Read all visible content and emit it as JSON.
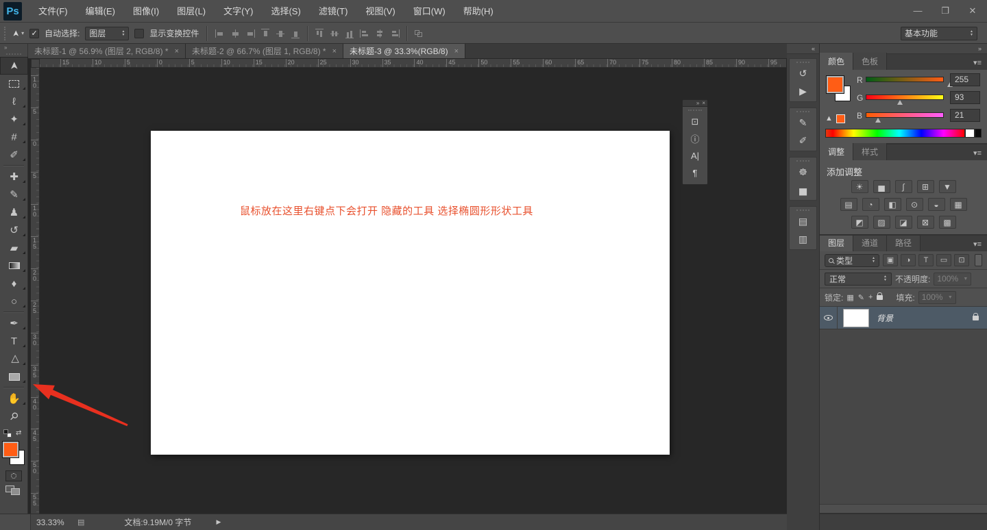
{
  "window": {
    "logo_text": "Ps",
    "minimize_glyph": "—",
    "maximize_glyph": "❐",
    "close_glyph": "✕"
  },
  "menu_items": [
    "文件(F)",
    "编辑(E)",
    "图像(I)",
    "图层(L)",
    "文字(Y)",
    "选择(S)",
    "滤镜(T)",
    "视图(V)",
    "窗口(W)",
    "帮助(H)"
  ],
  "options_bar": {
    "tool_glyph": "➤",
    "auto_select_label": "自动选择:",
    "auto_select_checked": true,
    "check_glyph": "✓",
    "target_value": "图层",
    "show_transform_label": "显示变换控件",
    "show_transform_checked": false,
    "align_icons": [
      "align-left",
      "align-hcenter",
      "align-right",
      "align-top",
      "align-vcenter",
      "align-bottom",
      "dist-top",
      "dist-vcenter",
      "dist-bottom",
      "dist-left",
      "dist-hcenter",
      "dist-right",
      "auto-align"
    ],
    "workspace_value": "基本功能"
  },
  "doc_tabs": [
    {
      "title": "未标题-1 @ 56.9% (图层 2, RGB/8) *",
      "close": "×",
      "active": false
    },
    {
      "title": "未标题-2 @ 66.7% (图层 1, RGB/8) *",
      "close": "×",
      "active": false
    },
    {
      "title": "未标题-3 @ 33.3%(RGB/8)",
      "close": "×",
      "active": true
    }
  ],
  "rulers": {
    "horizontal": [
      "15",
      "10",
      "5",
      "0",
      "5",
      "10",
      "15",
      "20",
      "25",
      "30",
      "35",
      "40",
      "45",
      "50",
      "55",
      "60",
      "65",
      "70",
      "75",
      "80",
      "85",
      "90",
      "95"
    ],
    "vertical": [
      "10",
      "5",
      "0",
      "5",
      "10",
      "15",
      "20",
      "25",
      "30",
      "35",
      "40",
      "45",
      "50",
      "55"
    ]
  },
  "toolbar": {
    "collapse_glyph": "»",
    "tools": [
      {
        "name": "move-tool",
        "glyph": "➤",
        "rot": -90,
        "selected": true,
        "flyout": false
      },
      {
        "name": "rectangular-marquee-tool",
        "glyph": "",
        "shape": "marquee",
        "flyout": true
      },
      {
        "name": "lasso-tool",
        "glyph": "ℓ",
        "flyout": true
      },
      {
        "name": "quick-selection-tool",
        "glyph": "✦",
        "flyout": true
      },
      {
        "name": "crop-tool",
        "glyph": "#",
        "flyout": true
      },
      {
        "name": "eyedropper-tool",
        "glyph": "✐",
        "flyout": true
      },
      {
        "name": "separator"
      },
      {
        "name": "spot-healing-brush-tool",
        "glyph": "✚",
        "flyout": true
      },
      {
        "name": "brush-tool",
        "glyph": "✎",
        "flyout": true
      },
      {
        "name": "clone-stamp-tool",
        "glyph": "♟",
        "flyout": true
      },
      {
        "name": "history-brush-tool",
        "glyph": "↺",
        "flyout": true
      },
      {
        "name": "eraser-tool",
        "glyph": "▰",
        "flyout": true
      },
      {
        "name": "gradient-tool",
        "glyph": "",
        "shape": "gradient",
        "flyout": true
      },
      {
        "name": "blur-tool",
        "glyph": "♦",
        "flyout": true
      },
      {
        "name": "dodge-tool",
        "glyph": "○",
        "flyout": true
      },
      {
        "name": "separator"
      },
      {
        "name": "pen-tool",
        "glyph": "✒",
        "flyout": true
      },
      {
        "name": "type-tool",
        "glyph": "T",
        "flyout": true
      },
      {
        "name": "path-selection-tool",
        "glyph": "▷",
        "rot": -90,
        "flyout": true
      },
      {
        "name": "rectangle-tool",
        "glyph": "",
        "shape": "rect",
        "flyout": true
      },
      {
        "name": "separator"
      },
      {
        "name": "hand-tool",
        "glyph": "✋",
        "flyout": true
      },
      {
        "name": "zoom-tool",
        "glyph": "⚲",
        "rot": 45,
        "flyout": false
      }
    ],
    "swap_glyph": "⇄"
  },
  "canvas": {
    "annotation_text": "鼠标放在这里右键点下会打开 隐藏的工具 选择椭圆形形状工具",
    "annotation_color": "#e8502d"
  },
  "float_panel": {
    "expand_glyph": "»",
    "close_glyph": "×",
    "icons": [
      {
        "name": "clone-source-icon",
        "glyph": "⊡"
      },
      {
        "name": "info-icon",
        "glyph": "ⓘ"
      },
      {
        "name": "character-panel-icon",
        "glyph": "A|"
      },
      {
        "name": "paragraph-panel-icon",
        "glyph": "¶"
      }
    ]
  },
  "dock": {
    "collapse_glyph": "«",
    "groups": [
      [
        {
          "name": "history-panel-icon",
          "glyph": "↺"
        },
        {
          "name": "actions-panel-icon",
          "glyph": "▶"
        }
      ],
      [
        {
          "name": "brush-panel-icon",
          "glyph": "✎"
        },
        {
          "name": "brush-presets-panel-icon",
          "glyph": "✐"
        }
      ],
      [
        {
          "name": "navigator-panel-icon",
          "glyph": "☸"
        },
        {
          "name": "histogram-panel-icon",
          "glyph": "▅"
        }
      ],
      [
        {
          "name": "properties-panel-icon",
          "glyph": "▤"
        },
        {
          "name": "paragraph-styles-panel-icon",
          "glyph": "▥"
        }
      ]
    ]
  },
  "right_column": {
    "collapse_glyph": "»",
    "panel_menu_glyph": "▾≡"
  },
  "color_panel": {
    "tabs": [
      {
        "label": "颜色",
        "active": true
      },
      {
        "label": "色板",
        "active": false
      }
    ],
    "foreground_color": "#ff5d15",
    "background_color": "#ffffff",
    "gamut_warning_glyph": "▲",
    "channels": [
      {
        "label": "R",
        "value": "255",
        "pct": 100,
        "from": "rgb(0,93,21)",
        "to": "rgb(255,93,21)"
      },
      {
        "label": "G",
        "value": "93",
        "pct": 36,
        "from": "rgb(255,0,21)",
        "to": "rgb(255,255,21)"
      },
      {
        "label": "B",
        "value": "21",
        "pct": 8,
        "from": "rgb(255,93,0)",
        "to": "rgb(255,93,255)"
      }
    ]
  },
  "adjustments_panel": {
    "tabs": [
      {
        "label": "调整",
        "active": true
      },
      {
        "label": "样式",
        "active": false
      }
    ],
    "title": "添加调整",
    "rows": [
      [
        {
          "name": "brightness-contrast-icon",
          "glyph": "☀"
        },
        {
          "name": "levels-icon",
          "glyph": "▅"
        },
        {
          "name": "curves-icon",
          "glyph": "∫"
        },
        {
          "name": "exposure-icon",
          "glyph": "⊞"
        },
        {
          "name": "vibrance-icon",
          "glyph": "▼"
        }
      ],
      [
        {
          "name": "hue-saturation-icon",
          "glyph": "▤"
        },
        {
          "name": "color-balance-icon",
          "glyph": "◔"
        },
        {
          "name": "black-white-icon",
          "glyph": "◧"
        },
        {
          "name": "photo-filter-icon",
          "glyph": "⊙"
        },
        {
          "name": "channel-mixer-icon",
          "glyph": "◒"
        },
        {
          "name": "color-lookup-icon",
          "glyph": "▦"
        }
      ],
      [
        {
          "name": "invert-icon",
          "glyph": "◩"
        },
        {
          "name": "posterize-icon",
          "glyph": "▨"
        },
        {
          "name": "threshold-icon",
          "glyph": "◪"
        },
        {
          "name": "selective-color-icon",
          "glyph": "⊠"
        },
        {
          "name": "gradient-map-icon",
          "glyph": "▩"
        }
      ]
    ]
  },
  "layers_panel": {
    "tabs": [
      {
        "label": "图层",
        "active": true
      },
      {
        "label": "通道",
        "active": false
      },
      {
        "label": "路径",
        "active": false
      }
    ],
    "filter_label": "类型",
    "filter_icons": [
      {
        "name": "filter-pixel-layers-icon",
        "glyph": "▣"
      },
      {
        "name": "filter-adjustment-layers-icon",
        "glyph": "◑"
      },
      {
        "name": "filter-type-layers-icon",
        "glyph": "T"
      },
      {
        "name": "filter-shape-layers-icon",
        "glyph": "▭"
      },
      {
        "name": "filter-smart-objects-icon",
        "glyph": "⊡"
      }
    ],
    "blend_mode": "正常",
    "opacity_label": "不透明度:",
    "opacity_value": "100%",
    "lock_label": "锁定:",
    "lock_icons": [
      {
        "name": "lock-transparent-pixels-icon",
        "glyph": "▦"
      },
      {
        "name": "lock-image-pixels-icon",
        "glyph": "✎"
      },
      {
        "name": "lock-position-icon",
        "glyph": "+"
      },
      {
        "name": "lock-all-icon",
        "glyph": "padlock"
      }
    ],
    "fill_label": "填充:",
    "fill_value": "100%",
    "layers": [
      {
        "name": "背景",
        "locked": true,
        "visible": true,
        "selected": true
      }
    ]
  },
  "status_bar": {
    "zoom": "33.33%",
    "page_icon": "▤",
    "doc_info": "文档:9.19M/0 字节",
    "expand_glyph": "▶"
  },
  "annotation_arrow_color": "#e8301f"
}
